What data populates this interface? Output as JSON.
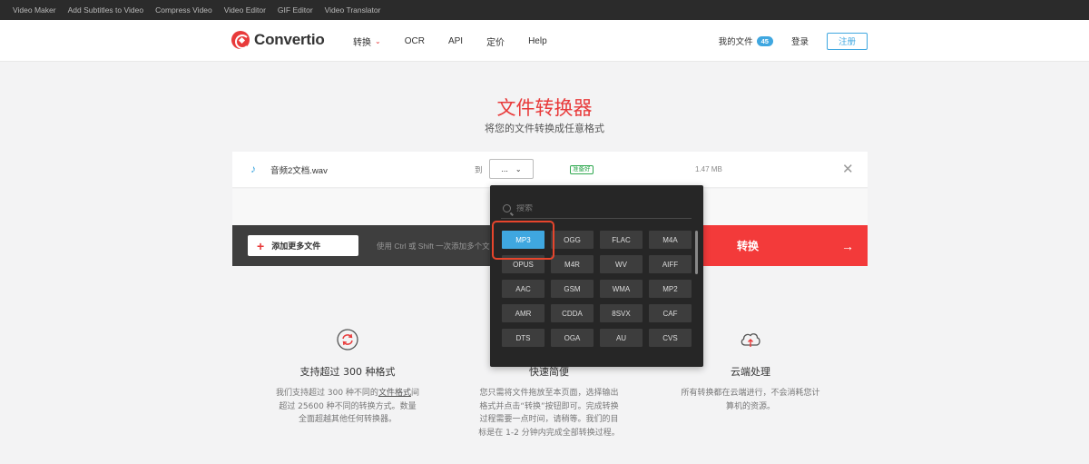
{
  "topbar": {
    "links": [
      "Video Maker",
      "Add Subtitles to Video",
      "Compress Video",
      "Video Editor",
      "GIF Editor",
      "Video Translator"
    ]
  },
  "header": {
    "logo_text": "Convertio",
    "nav": [
      "转换",
      "OCR",
      "API",
      "定价",
      "Help"
    ],
    "my_files_label": "我的文件",
    "my_files_count": "45",
    "login_label": "登录",
    "register_label": "注册"
  },
  "hero": {
    "title": "文件转换器",
    "subtitle": "将您的文件转换成任意格式"
  },
  "file": {
    "icon": "music-note-icon",
    "name": "音频2文档.wav",
    "to_label": "到",
    "selected_format": "...",
    "status": "准备好",
    "size": "1.47 MB"
  },
  "actions": {
    "add_more_label": "添加更多文件",
    "hint": "使用 Ctrl 或 Shift 一次添加多个文件",
    "convert_label": "转换"
  },
  "dropdown": {
    "search_placeholder": "搜索",
    "formats": [
      "MP3",
      "OGG",
      "FLAC",
      "M4A",
      "OPUS",
      "M4R",
      "WV",
      "AIFF",
      "AAC",
      "GSM",
      "WMA",
      "MP2",
      "AMR",
      "CDDA",
      "8SVX",
      "CAF",
      "DTS",
      "OGA",
      "AU",
      "CVS"
    ],
    "selected": "MP3"
  },
  "features": [
    {
      "icon": "refresh-circle-icon",
      "title": "支持超过 300 种格式",
      "desc_1": "我们支持超过 300 种不同的",
      "desc_link": "文件格式",
      "desc_2": "间超过 25600 种不同的转换方式。数量全面超越其他任何转换器。"
    },
    {
      "icon": "speed-icon",
      "title": "快速简便",
      "desc": "您只需将文件拖放至本页面，选择输出格式并点击“转换”按钮即可。完成转换过程需要一点时间，请稍等。我们的目标是在 1-2 分钟内完成全部转换过程。"
    },
    {
      "icon": "cloud-upload-icon",
      "title": "云端处理",
      "desc": "所有转换都在云端进行，不会消耗您计算机的资源。"
    }
  ],
  "colors": {
    "brand_red": "#e83a3a",
    "accent_blue": "#3fa7e0",
    "convert_red": "#f33a3a",
    "dropdown_bg": "#262626",
    "highlight_box": "#e7452c"
  }
}
